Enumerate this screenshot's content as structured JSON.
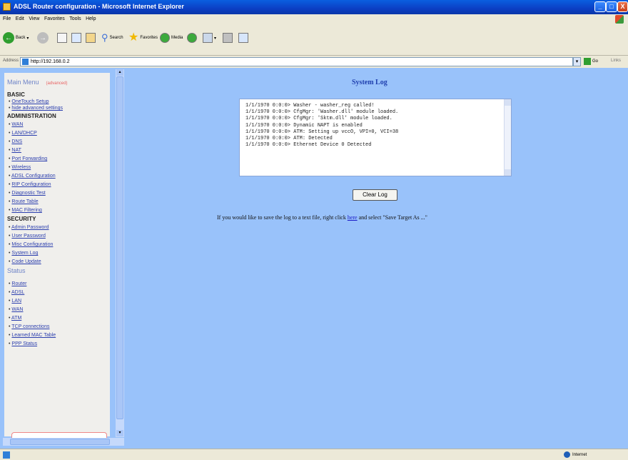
{
  "window": {
    "title": "ADSL Router configuration - Microsoft Internet Explorer",
    "minimize": "_",
    "maximize": "□",
    "close": "X"
  },
  "menubar": [
    "File",
    "Edit",
    "View",
    "Favorites",
    "Tools",
    "Help"
  ],
  "toolbar": {
    "back": "Back",
    "search": "Search",
    "favorites": "Favorites",
    "media": "Media"
  },
  "address": {
    "label": "Address",
    "url": "http://192.168.0.2",
    "go": "Go",
    "links": "Links"
  },
  "sidebar": {
    "main_menu": "Main Menu",
    "advanced": "(advanced)",
    "sections": [
      {
        "title": "BASIC",
        "items": [
          "OneTouch Setup",
          "hide advanced settings"
        ]
      },
      {
        "title": "ADMINISTRATION",
        "items": [
          "WAN",
          "LAN/DHCP",
          "DNS",
          "NAT",
          "Port Forwarding",
          "Wireless",
          "ADSL Configuration",
          "RIP Configuration",
          "Diagnostic Test",
          "Route Table",
          "MAC Filtering"
        ]
      },
      {
        "title": "SECURITY",
        "items": [
          "Admin Password",
          "User Password",
          "Misc Configuration",
          "System Log",
          "Code Update"
        ]
      }
    ],
    "status_title": "Status",
    "status_items": [
      "Router",
      "ADSL",
      "LAN",
      "WAN",
      "ATM",
      "TCP connections",
      "Learned MAC Table",
      "PPP Status"
    ]
  },
  "main": {
    "title": "System Log",
    "log_lines": [
      "1/1/1970 0:0:0> Washer - washer_reg called!",
      "1/1/1970 0:0:0> CfgMgr: 'Washer.dll' module loaded.",
      "1/1/1970 0:0:0> CfgMgr: 'Sktm.dll' module loaded.",
      "1/1/1970 0:0:0> Dynamic NAPT is enabled",
      "1/1/1970 0:0:0> ATM: Setting up vccO, VPI=0, VCI=38",
      "1/1/1970 0:0:0> ATM: Detected",
      "1/1/1970 0:0:0> Ethernet Device 0 Detected"
    ],
    "clear_button": "Clear Log",
    "info_prefix": "If you would like to save the log to a text file, right click ",
    "info_link": "here",
    "info_suffix": " and select \"Save Target As ...\""
  },
  "statusbar": {
    "zone": "Internet"
  }
}
